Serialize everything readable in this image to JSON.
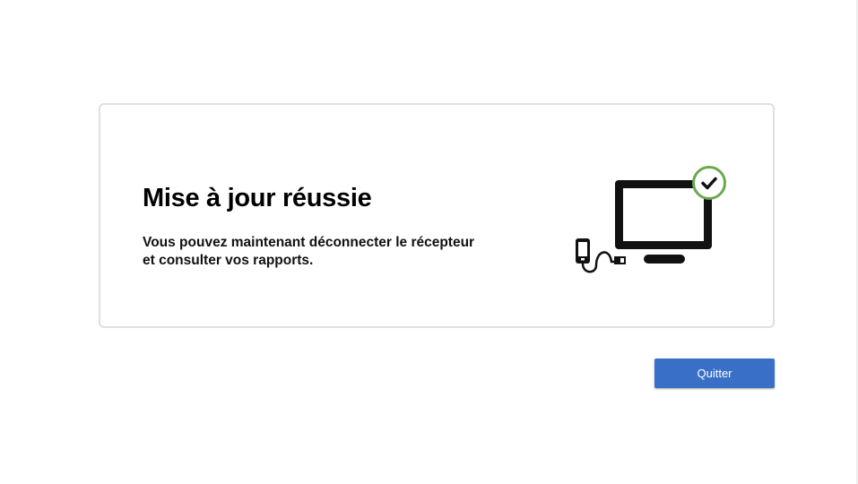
{
  "card": {
    "title": "Mise à jour réussie",
    "message_line1": "Vous pouvez maintenant déconnecter le récepteur",
    "message_line2": "et consulter vos rapports.",
    "illustration_icon": "tv-connected-success-icon",
    "check_color": "#6aa84f"
  },
  "actions": {
    "quit_label": "Quitter",
    "quit_color": "#3a6fc8"
  }
}
